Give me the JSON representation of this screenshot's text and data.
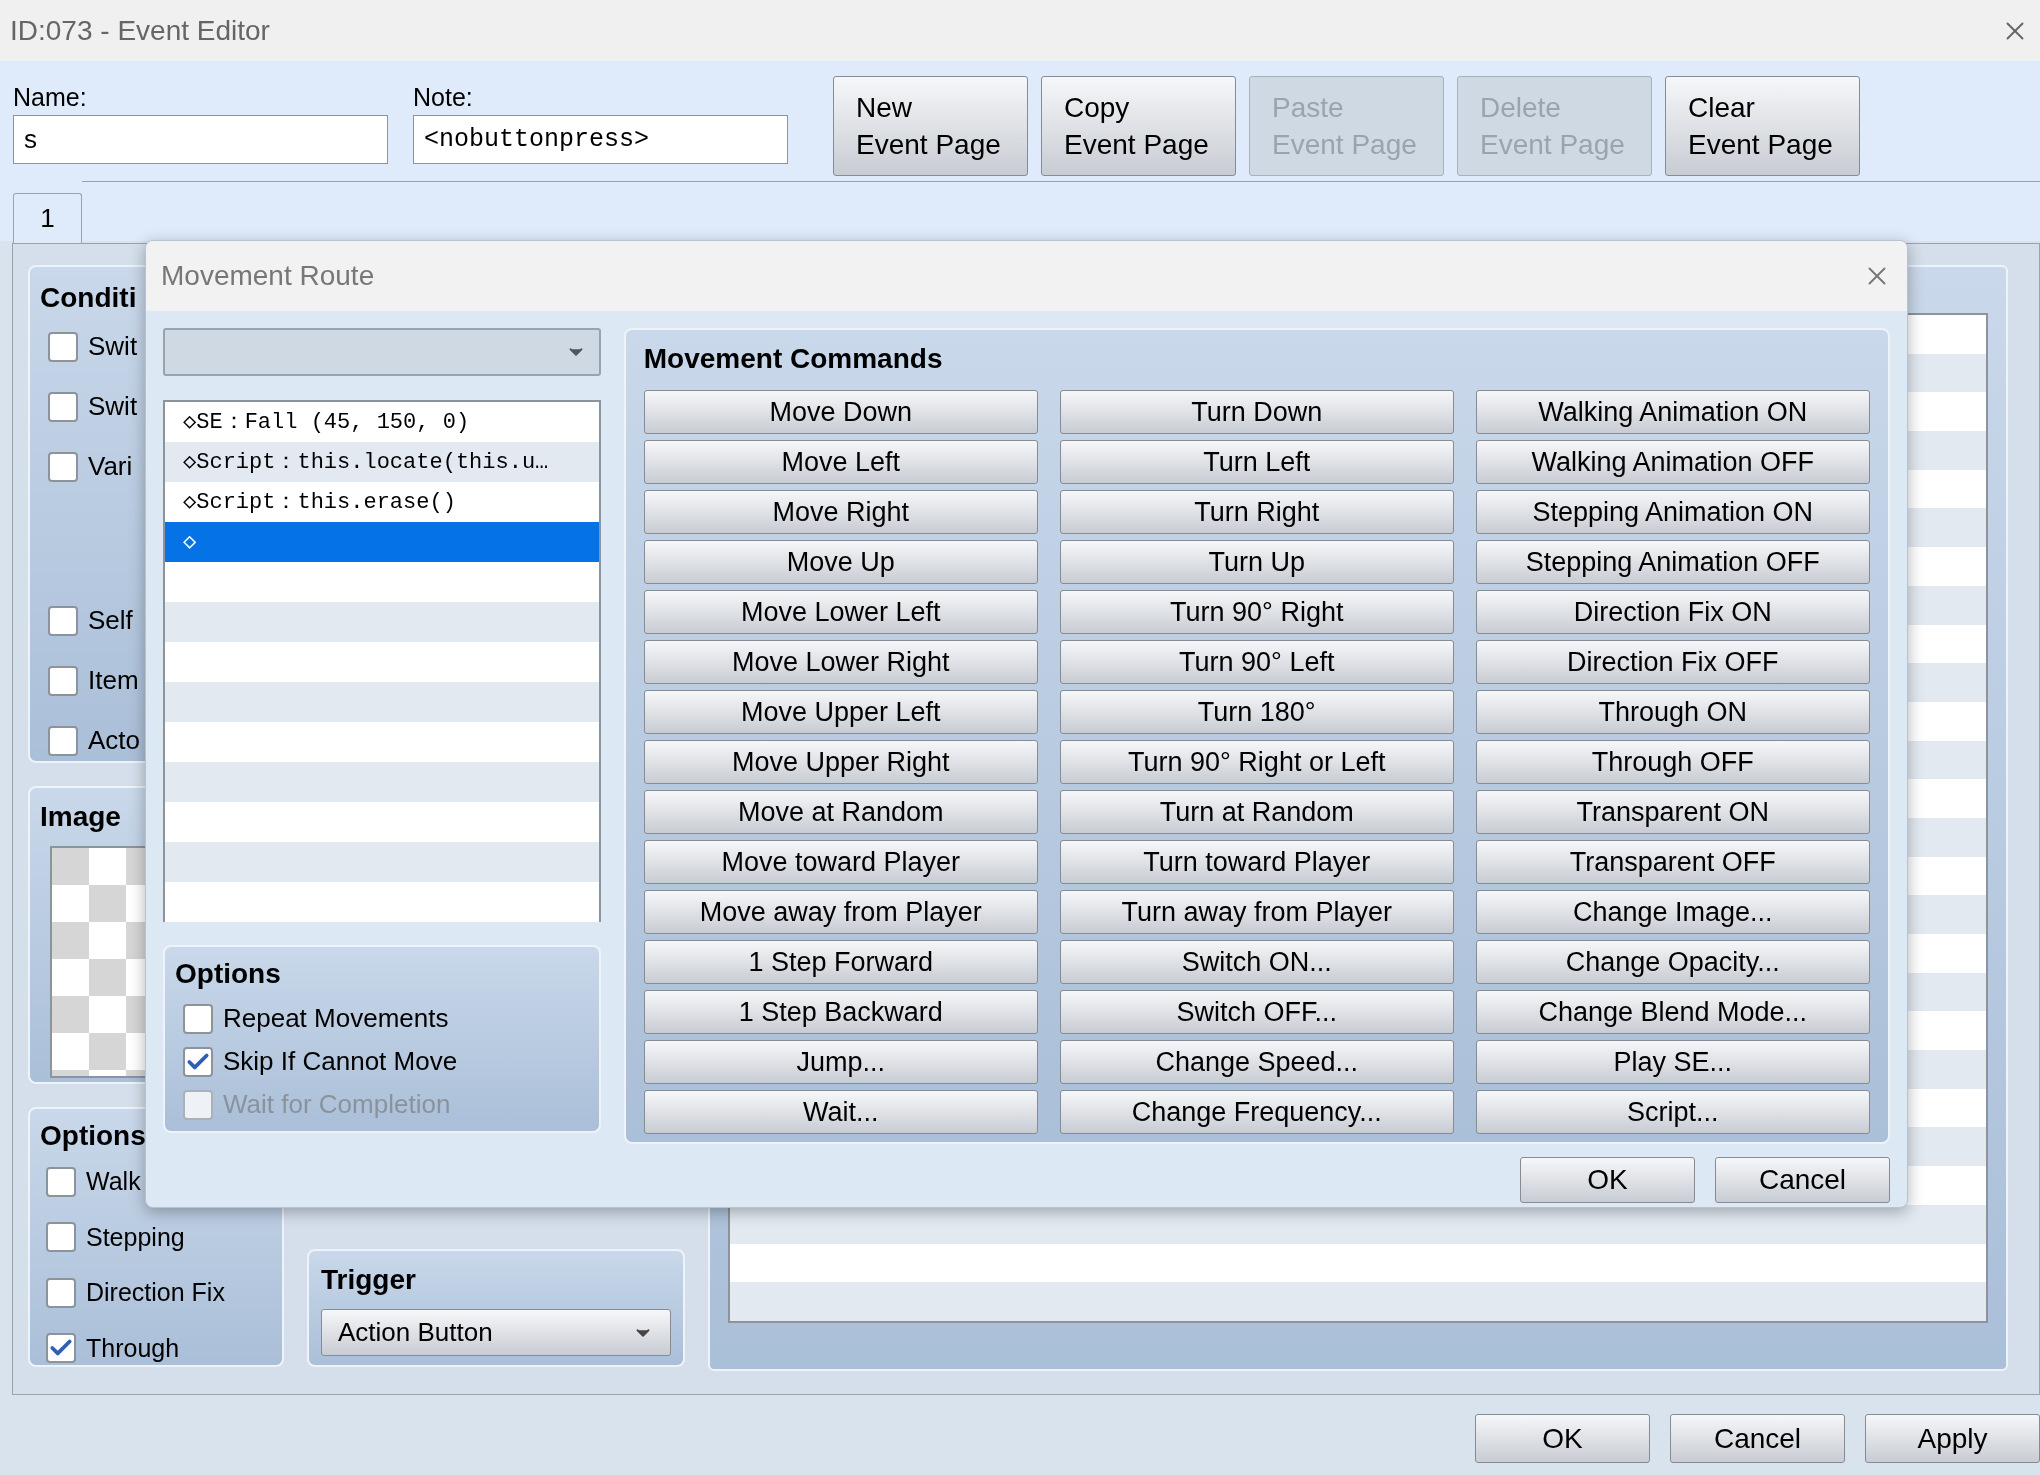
{
  "window": {
    "title": "ID:073 - Event Editor"
  },
  "name": {
    "label": "Name:",
    "value": "s"
  },
  "note": {
    "label": "Note:",
    "value": "<nobuttonpress>"
  },
  "page_buttons": [
    {
      "lines": [
        "New",
        "Event Page"
      ],
      "disabled": false
    },
    {
      "lines": [
        "Copy",
        "Event Page"
      ],
      "disabled": false
    },
    {
      "lines": [
        "Paste",
        "Event Page"
      ],
      "disabled": true
    },
    {
      "lines": [
        "Delete",
        "Event Page"
      ],
      "disabled": true
    },
    {
      "lines": [
        "Clear",
        "Event Page"
      ],
      "disabled": false
    }
  ],
  "tabs": [
    {
      "label": "1",
      "selected": true
    }
  ],
  "conditions": {
    "title": "Conditi",
    "items": [
      {
        "label": "Swit",
        "checked": false
      },
      {
        "label": "Swit",
        "checked": false
      },
      {
        "label": "Vari",
        "checked": false
      },
      {
        "label": "Self",
        "checked": false
      },
      {
        "label": "Item",
        "checked": false
      },
      {
        "label": "Acto",
        "checked": false
      }
    ]
  },
  "image": {
    "title": "Image"
  },
  "options": {
    "title": "Options",
    "items": [
      {
        "label": "Walk",
        "checked": false
      },
      {
        "label": "Stepping",
        "checked": false
      },
      {
        "label": "Direction Fix",
        "checked": false
      },
      {
        "label": "Through",
        "checked": true
      }
    ]
  },
  "trigger": {
    "title": "Trigger",
    "value": "Action Button"
  },
  "buttons": [
    {
      "label": "OK"
    },
    {
      "label": "Cancel"
    },
    {
      "label": "Apply"
    }
  ],
  "dialog": {
    "title": "Movement Route",
    "route": [
      {
        "text": "◇SE：Fall (45, 150, 0)",
        "selected": false
      },
      {
        "text": "◇Script：this.locate(this.u…",
        "selected": false
      },
      {
        "text": "◇Script：this.erase()",
        "selected": false
      },
      {
        "text": "◇",
        "selected": true
      }
    ],
    "options": {
      "title": "Options",
      "items": [
        {
          "label": "Repeat Movements",
          "checked": false,
          "disabled": false
        },
        {
          "label": "Skip If Cannot Move",
          "checked": true,
          "disabled": false
        },
        {
          "label": "Wait for Completion",
          "checked": false,
          "disabled": true
        }
      ]
    },
    "commands": {
      "title": "Movement Commands",
      "columns": [
        [
          "Move Down",
          "Move Left",
          "Move Right",
          "Move Up",
          "Move Lower Left",
          "Move Lower Right",
          "Move Upper Left",
          "Move Upper Right",
          "Move at Random",
          "Move toward Player",
          "Move away from Player",
          "1 Step Forward",
          "1 Step Backward",
          "Jump...",
          "Wait..."
        ],
        [
          "Turn Down",
          "Turn Left",
          "Turn Right",
          "Turn Up",
          "Turn 90° Right",
          "Turn 90° Left",
          "Turn 180°",
          "Turn 90° Right or Left",
          "Turn at Random",
          "Turn toward Player",
          "Turn away from Player",
          "Switch ON...",
          "Switch OFF...",
          "Change Speed...",
          "Change Frequency..."
        ],
        [
          "Walking Animation ON",
          "Walking Animation OFF",
          "Stepping Animation ON",
          "Stepping Animation OFF",
          "Direction Fix ON",
          "Direction Fix OFF",
          "Through ON",
          "Through OFF",
          "Transparent ON",
          "Transparent OFF",
          "Change Image...",
          "Change Opacity...",
          "Change Blend Mode...",
          "Play SE...",
          "Script..."
        ]
      ]
    },
    "buttons": [
      {
        "label": "OK"
      },
      {
        "label": "Cancel"
      }
    ]
  }
}
